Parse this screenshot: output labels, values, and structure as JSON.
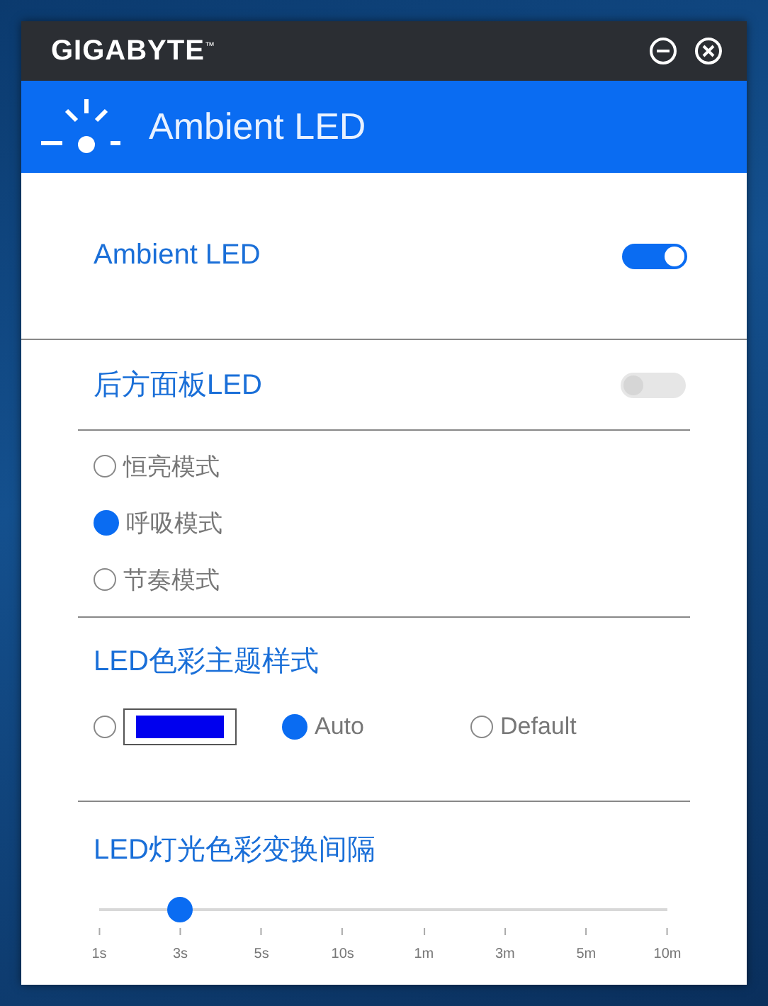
{
  "window": {
    "brand": "GIGABYTE$^{™}$"
  },
  "header": {
    "title": "Ambient LED"
  },
  "master": {
    "label": "Ambient LED",
    "on": true
  },
  "rear_panel": {
    "label": "后方面板LED",
    "on": false
  },
  "modes": [
    {
      "label": "恒亮模式",
      "selected": false
    },
    {
      "label": "呼吸模式",
      "selected": true
    },
    {
      "label": "节奏模式",
      "selected": false
    }
  ],
  "color_theme": {
    "title": "LED色彩主题样式",
    "options": [
      {
        "kind": "swatch",
        "color": "#0000ee",
        "selected": false
      },
      {
        "kind": "text",
        "label": "Auto",
        "selected": true
      },
      {
        "kind": "text",
        "label": "Default",
        "selected": false
      }
    ]
  },
  "interval": {
    "title": "LED灯光色彩变换间隔",
    "level": 0.1429,
    "ticks": [
      "1s",
      "3s",
      "5s",
      "10s",
      "1m",
      "3m",
      "5m",
      "10m"
    ]
  }
}
